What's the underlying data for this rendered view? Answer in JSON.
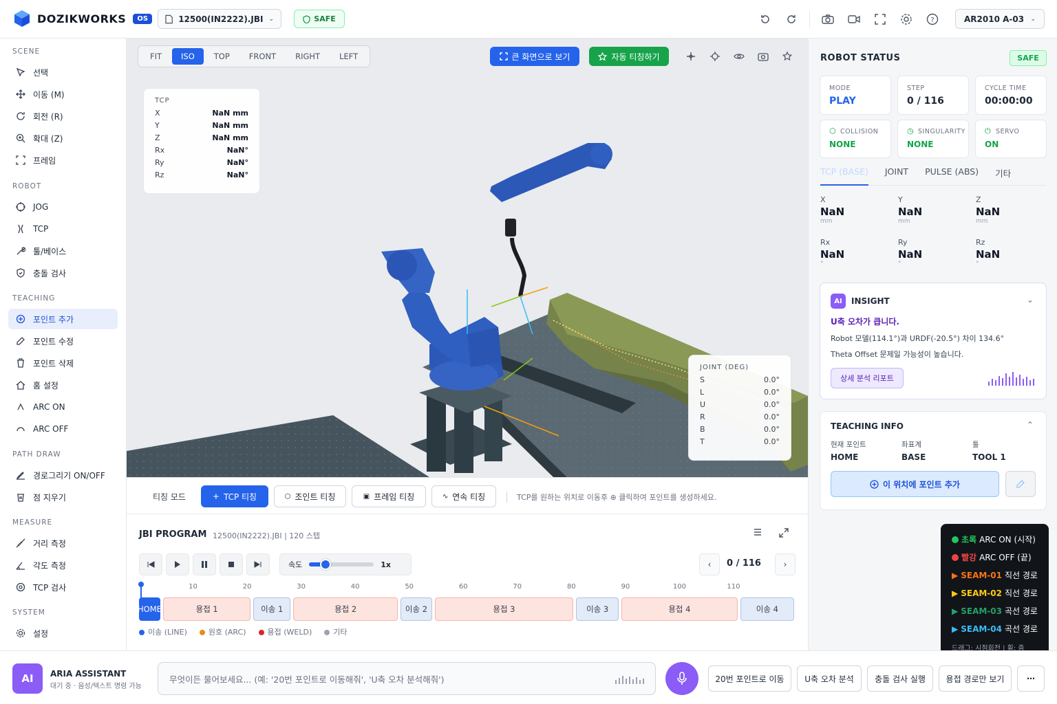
{
  "header": {
    "app_name": "DOZIKWORKS",
    "os_badge": "OS",
    "file_name": "12500(IN2222).JBI",
    "safe_label": "SAFE",
    "robot_model": "AR2010 A-03",
    "brand_color": "#2563eb",
    "icons": [
      "undo-icon",
      "redo-icon",
      "camera-icon",
      "video-icon",
      "fullscreen-icon",
      "settings-icon",
      "help-icon"
    ]
  },
  "sidebar": {
    "sections": [
      {
        "title": "SCENE",
        "items": [
          "선택",
          "이동 (M)",
          "회전 (R)",
          "확대 (Z)",
          "프레임"
        ]
      },
      {
        "title": "ROBOT",
        "items": [
          "JOG",
          "TCP",
          "툴/베이스",
          "충돌 검사"
        ]
      },
      {
        "title": "TEACHING",
        "items": [
          "포인트 추가",
          "포인트 수정",
          "포인트 삭제",
          "홈 설정",
          "ARC ON",
          "ARC OFF"
        ]
      },
      {
        "title": "PATH DRAW",
        "items": [
          "경로그리기 ON/OFF",
          "점 지우기"
        ]
      },
      {
        "title": "MEASURE",
        "items": [
          "거리 측정",
          "각도 측정",
          "TCP 검사"
        ]
      },
      {
        "title": "SYSTEM",
        "items": [
          "설정"
        ]
      }
    ],
    "active_item": "포인트 추가"
  },
  "viewport": {
    "view_tabs": [
      "FIT",
      "ISO",
      "TOP",
      "FRONT",
      "RIGHT",
      "LEFT"
    ],
    "active_view": "ISO",
    "fullscreen_button": "큰 화면으로 보기",
    "auto_teach_button": "자동 티칭하기",
    "tcp_panel": {
      "title": "TCP",
      "rows": [
        {
          "k": "X",
          "v": "NaN mm"
        },
        {
          "k": "Y",
          "v": "NaN mm"
        },
        {
          "k": "Z",
          "v": "NaN mm"
        },
        {
          "k": "Rx",
          "v": "NaN°"
        },
        {
          "k": "Ry",
          "v": "NaN°"
        },
        {
          "k": "Rz",
          "v": "NaN°"
        }
      ]
    },
    "joint_panel": {
      "title": "JOINT (DEG)",
      "rows": [
        {
          "k": "S",
          "v": "0.0°"
        },
        {
          "k": "L",
          "v": "0.0°"
        },
        {
          "k": "U",
          "v": "0.0°"
        },
        {
          "k": "R",
          "v": "0.0°"
        },
        {
          "k": "B",
          "v": "0.0°"
        },
        {
          "k": "T",
          "v": "0.0°"
        }
      ]
    }
  },
  "teaching_bar": {
    "label": "티칭 모드",
    "buttons": [
      "TCP 티칭",
      "조인트 티칭",
      "프레임 티칭",
      "연속 티칭"
    ],
    "hint": "TCP를 원하는 위치로 이동후 ⊕ 클릭하여 포인트를 생성하세요."
  },
  "program": {
    "title": "JBI PROGRAM",
    "subtitle": "12500(IN2222).JBI | 120 스텝",
    "speed_label": "속도",
    "speed_value": "1x",
    "speed_fraction": 0.25,
    "step_display": "0 / 116",
    "ruler_ticks": [
      "10",
      "20",
      "30",
      "40",
      "50",
      "60",
      "70",
      "80",
      "90",
      "100",
      "110"
    ],
    "segments": [
      {
        "label": "HOME",
        "type": "home",
        "start": 0,
        "end": 4
      },
      {
        "label": "용접 1",
        "type": "weld",
        "start": 4,
        "end": 20
      },
      {
        "label": "이송 1",
        "type": "move",
        "start": 20,
        "end": 27
      },
      {
        "label": "용접 2",
        "type": "weld",
        "start": 27,
        "end": 46
      },
      {
        "label": "이송 2",
        "type": "move",
        "start": 46,
        "end": 52
      },
      {
        "label": "용접 3",
        "type": "weld",
        "start": 52,
        "end": 77
      },
      {
        "label": "이송 3",
        "type": "move",
        "start": 77,
        "end": 85
      },
      {
        "label": "용접 4",
        "type": "weld",
        "start": 85,
        "end": 106
      },
      {
        "label": "이송 4",
        "type": "move",
        "start": 106,
        "end": 116
      }
    ],
    "legend": [
      {
        "label": "이송 (LINE)",
        "color": "#2563eb"
      },
      {
        "label": "원호 (ARC)",
        "color": "#ea8a1c"
      },
      {
        "label": "용접 (WELD)",
        "color": "#dc2626"
      },
      {
        "label": "기타",
        "color": "#9ca3af"
      }
    ]
  },
  "robot_status": {
    "title": "ROBOT STATUS",
    "safe_label": "SAFE",
    "cards": [
      {
        "label": "MODE",
        "value": "PLAY",
        "color": "#2563eb"
      },
      {
        "label": "STEP",
        "value": "0 / 116",
        "color": "#111827"
      },
      {
        "label": "CYCLE TIME",
        "value": "00:00:00",
        "color": "#111827"
      },
      {
        "label": "COLLISION",
        "value": "NONE",
        "color": "#16a34a"
      },
      {
        "label": "SINGULARITY",
        "value": "NONE",
        "color": "#16a34a"
      },
      {
        "label": "SERVO",
        "value": "ON",
        "color": "#16a34a"
      }
    ],
    "tabs": [
      "TCP (BASE)",
      "JOINT",
      "PULSE (ABS)",
      "기타"
    ],
    "active_tab": "TCP (BASE)",
    "coords": [
      {
        "k": "X",
        "v": "NaN",
        "u": "mm"
      },
      {
        "k": "Y",
        "v": "NaN",
        "u": "mm"
      },
      {
        "k": "Z",
        "v": "NaN",
        "u": "mm"
      },
      {
        "k": "Rx",
        "v": "NaN",
        "u": "°"
      },
      {
        "k": "Ry",
        "v": "NaN",
        "u": "°"
      },
      {
        "k": "Rz",
        "v": "NaN",
        "u": "°"
      }
    ]
  },
  "insight": {
    "badge": "AI",
    "title": "INSIGHT",
    "headline": "U축 오차가 큽니다.",
    "line1": "Robot 모델(114.1°)과 URDF(-20.5°) 차이 134.6°",
    "line2": "Theta Offset 문제일 가능성이 높습니다.",
    "report_button": "상세 분석 리포트"
  },
  "teaching_info": {
    "title": "TEACHING INFO",
    "fields": [
      {
        "k": "현재 포인트",
        "v": "HOME"
      },
      {
        "k": "좌표계",
        "v": "BASE"
      },
      {
        "k": "툴",
        "v": "TOOL 1"
      }
    ],
    "add_button": "이 위치에 포인트 추가"
  },
  "arc_legend": {
    "rows": [
      {
        "tag": "초록",
        "text": "ARC ON (시작)",
        "color": "#22c55e"
      },
      {
        "tag": "빨강",
        "text": "ARC OFF (끝)",
        "color": "#ef4444"
      },
      {
        "tag": "SEAM-01",
        "text": "직선 경로",
        "color": "#f97316"
      },
      {
        "tag": "SEAM-02",
        "text": "직선 경로",
        "color": "#facc15"
      },
      {
        "tag": "SEAM-03",
        "text": "곡선 경로",
        "color": "#22a06b"
      },
      {
        "tag": "SEAM-04",
        "text": "곡선 경로",
        "color": "#38bdf8"
      }
    ],
    "footer": "드래그: 시점회전 | 휠: 줌"
  },
  "assistant": {
    "badge": "AI",
    "name": "ARIA ASSISTANT",
    "status": "대기 중 · 음성/텍스트 명령 가능",
    "placeholder": "무엇이든 물어보세요... (예: '20번 포인트로 이동해줘', 'U축 오차 분석해줘')",
    "quick_actions": [
      "20번 포인트로 이동",
      "U축 오차 분석",
      "충돌 검사 실행",
      "용접 경로만 보기"
    ],
    "more": "⋯"
  }
}
